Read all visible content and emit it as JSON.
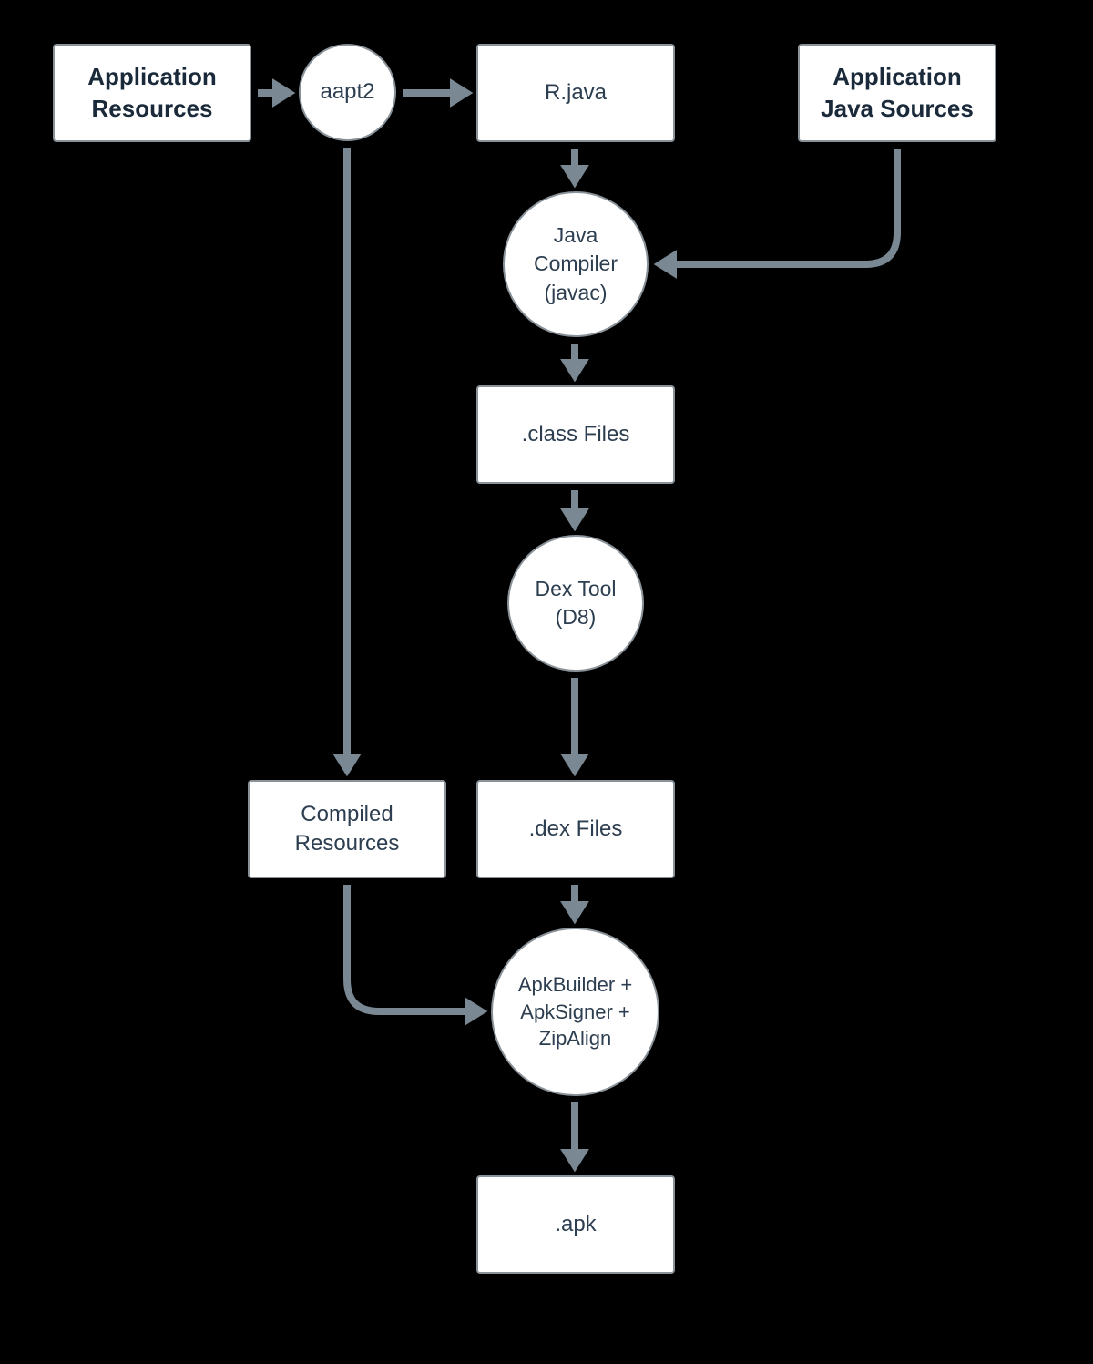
{
  "nodes": {
    "app_resources": "Application Resources",
    "aapt2": "aapt2",
    "r_java": "R.java",
    "app_java_sources": "Application Java Sources",
    "javac": "Java Compiler (javac)",
    "class_files": ".class Files",
    "dex_tool": "Dex Tool (D8)",
    "compiled_resources": "Compiled Resources",
    "dex_files": ".dex Files",
    "apkbuilder": "ApkBuilder + ApkSigner + ZipAlign",
    "apk": ".apk"
  },
  "colors": {
    "box_border": "#8a9299",
    "arrow": "#7a8893",
    "text": "#2c3e50",
    "bold_text": "#1a2a3a",
    "background": "#000000",
    "box_bg": "#ffffff"
  }
}
